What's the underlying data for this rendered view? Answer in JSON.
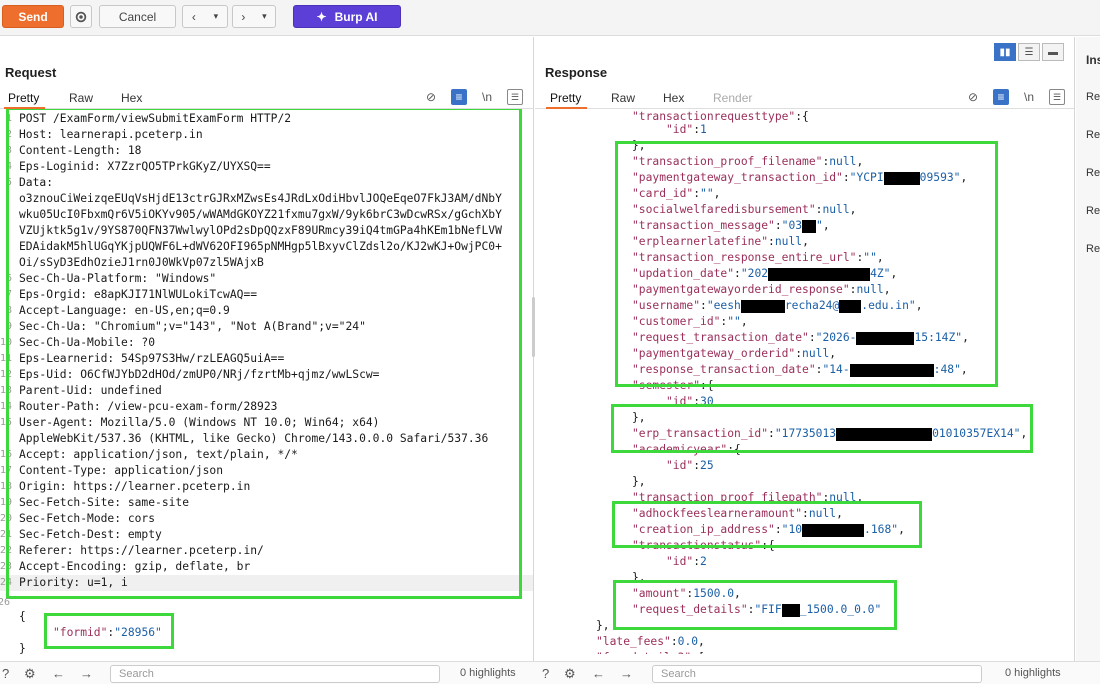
{
  "toolbar": {
    "send_label": "Send",
    "cancel_label": "Cancel",
    "burp_ai_label": "Burp AI"
  },
  "request": {
    "title": "Request",
    "tabs": [
      "Pretty",
      "Raw",
      "Hex"
    ],
    "newline_label": "\\n",
    "lines": [
      "POST /ExamForm/viewSubmitExamForm HTTP/2",
      "Host: learnerapi.pceterp.in",
      "Content-Length: 18",
      "Eps-Loginid: X7ZzrQO5TPrkGKyZ/UYXSQ==",
      "Data:",
      "o3znouCiWeizqeEUqVsHjdE13ctrGJRxMZwsEs4JRdLxOdiHbvlJOQeEqeO7FkJ3AM/dNbY",
      "wku05UcI0FbxmQr6V5iOKYv905/wWAMdGKOYZ21fxmu7gxW/9yk6brC3wDcwRSx/gGchXbY",
      "VZUjktk5g1v/9YS870QFN37WwlwylOPd2sDpQQzxF89URmcy39iQ4tmGPa4hKEm1bNefLVW",
      "EDAidakM5hlUGqYKjpUQWF6L+dWV62OFI965pNMHgp5lBxyvClZdsl2o/KJ2wKJ+OwjPC0+",
      "Oi/sSyD3EdhOzieJ1rn0J0WkVp07zl5WAjxB",
      "Sec-Ch-Ua-Platform: \"Windows\"",
      "Eps-Orgid: e8apKJI71NlWULokiTcwAQ==",
      "Accept-Language: en-US,en;q=0.9",
      "Sec-Ch-Ua: \"Chromium\";v=\"143\", \"Not A(Brand\";v=\"24\"",
      "Sec-Ch-Ua-Mobile: ?0",
      "Eps-Learnerid: 54Sp97S3Hw/rzLEAGQ5uiA==",
      "Eps-Uid: O6CfWJYbD2dHOd/zmUP0/NRj/fzrtMb+qjmz/wwLScw=",
      "Parent-Uid: undefined",
      "Router-Path: /view-pcu-exam-form/28923",
      "User-Agent: Mozilla/5.0 (Windows NT 10.0; Win64; x64)",
      "AppleWebKit/537.36 (KHTML, like Gecko) Chrome/143.0.0.0 Safari/537.36",
      "Accept: application/json, text/plain, */*",
      "Content-Type: application/json",
      "Origin: https://learner.pceterp.in",
      "Sec-Fetch-Site: same-site",
      "Sec-Fetch-Mode: cors",
      "Sec-Fetch-Dest: empty",
      "Referer: https://learner.pceterp.in/",
      "Accept-Encoding: gzip, deflate, br",
      "Priority: u=1, i"
    ],
    "line_numbers": [
      "1",
      "2",
      "3",
      "4",
      "5",
      "",
      "",
      "",
      "",
      "",
      "6",
      "7",
      "8",
      "9",
      "10",
      "11",
      "12",
      "13",
      "14",
      "15",
      "",
      "16",
      "17",
      "18",
      "19",
      "20",
      "21",
      "22",
      "23",
      "24"
    ],
    "body_open": "{",
    "body_key": "\"formid\"",
    "body_value": "\"28956\"",
    "body_close": "}",
    "body_line_number": "26"
  },
  "response": {
    "title": "Response",
    "tabs": [
      "Pretty",
      "Raw",
      "Hex",
      "Render"
    ],
    "newline_label": "\\n"
  },
  "inspector": {
    "title": "Ins",
    "items": [
      "Re",
      "Re",
      "Re",
      "Re",
      "Re"
    ]
  },
  "bottom": {
    "search_placeholder": "Search",
    "highlights_label": "0 highlights"
  }
}
